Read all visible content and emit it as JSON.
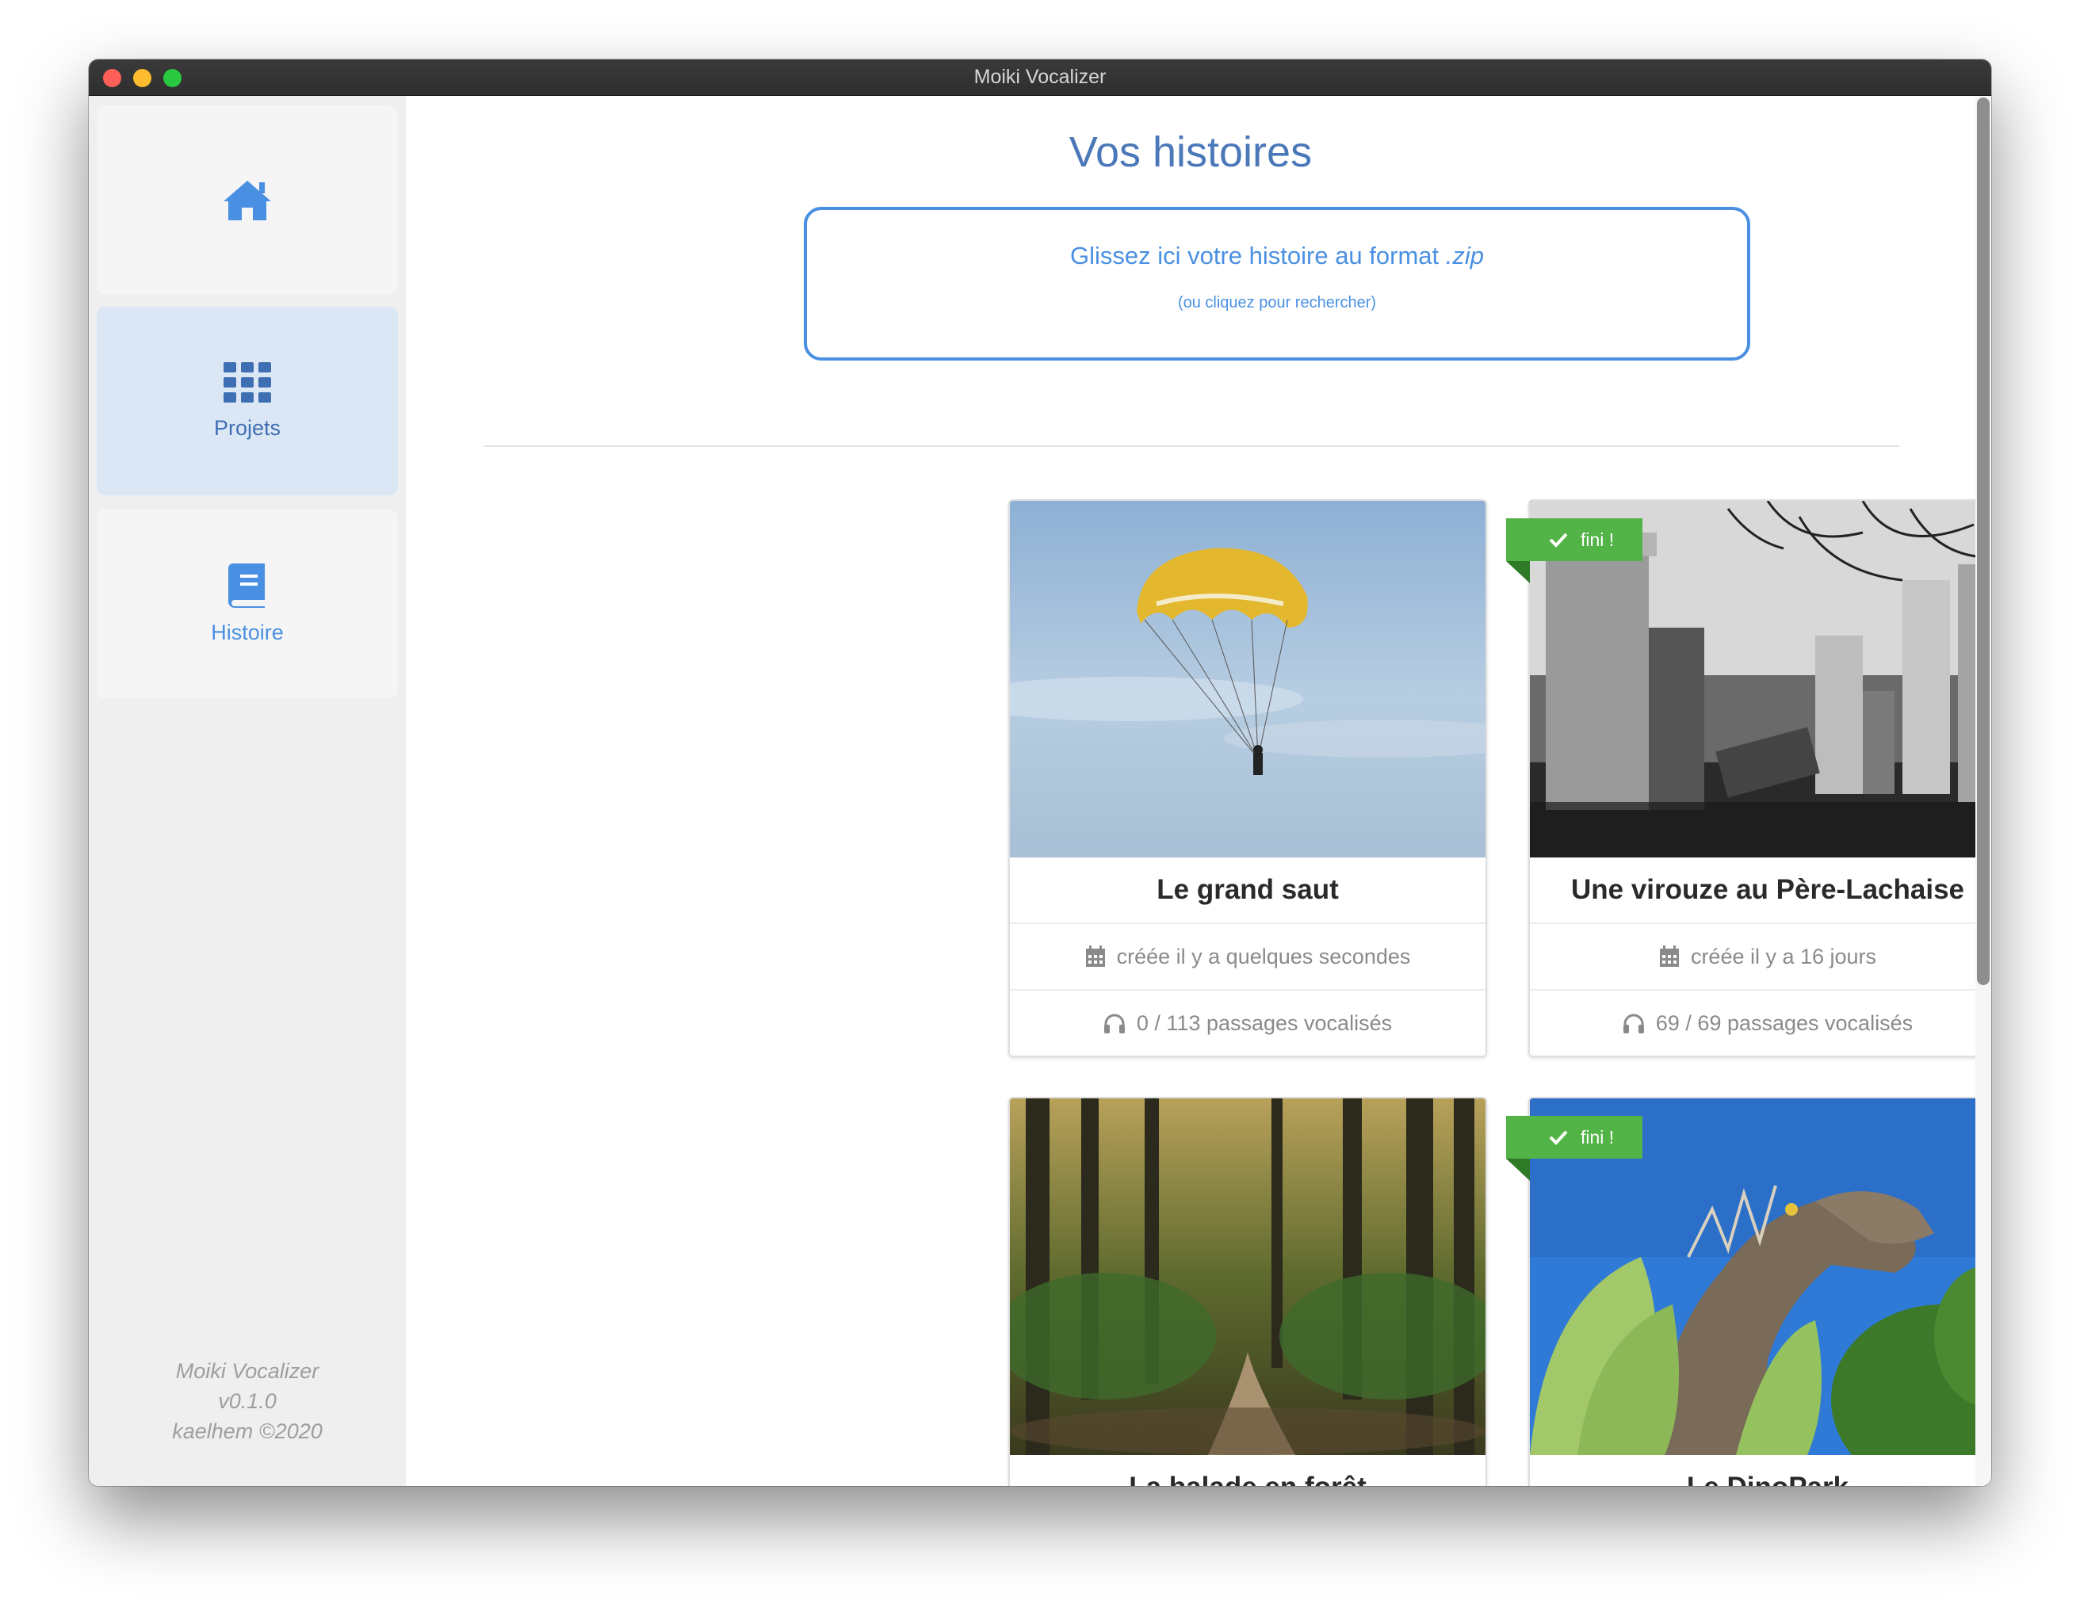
{
  "window": {
    "title": "Moiki Vocalizer"
  },
  "sidebar": {
    "items": [
      {
        "label": "",
        "icon": "home-icon"
      },
      {
        "label": "Projets",
        "icon": "grid-icon",
        "active": true
      },
      {
        "label": "Histoire",
        "icon": "book-icon"
      }
    ],
    "footer": {
      "app_name": "Moiki Vocalizer",
      "version": "v0.1.0",
      "author": "kaelhem ©2020"
    }
  },
  "main": {
    "title": "Vos histoires",
    "dropzone": {
      "text": "Glissez ici votre histoire au format ",
      "format": ".zip",
      "subtext": "(ou cliquez pour rechercher)"
    },
    "cards": [
      {
        "title": "Le grand saut",
        "created": "créée il y a quelques secondes",
        "passages": "0 / 113 passages vocalisés",
        "finished": false,
        "image": "parachute"
      },
      {
        "title": "Une virouze au Père-Lachaise",
        "created": "créée il y a 16 jours",
        "passages": "69 / 69 passages vocalisés",
        "finished": true,
        "badge": "fini !",
        "image": "cemetery"
      },
      {
        "title": "La balade en forêt",
        "finished": false,
        "image": "forest"
      },
      {
        "title": "Le DinoPark",
        "finished": true,
        "badge": "fini !",
        "image": "dinosaur"
      }
    ]
  },
  "colors": {
    "accent": "#4a90e2",
    "title": "#4b78b8",
    "badge": "#52b447",
    "sidebar_active": "#dce7f6"
  }
}
